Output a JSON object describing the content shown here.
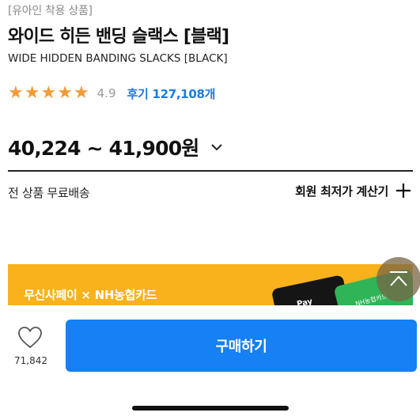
{
  "product": {
    "tag": "[유아인 착용 상품]",
    "title": "와이드 히든 밴딩 슬랙스 [블랙]",
    "subtitle": "WIDE HIDDEN BANDING SLACKS [BLACK]"
  },
  "rating": {
    "stars": 5,
    "star_color": "#f29b38",
    "score": "4.9",
    "reviews_label": "후기 127,108개"
  },
  "price": {
    "range": "40,224 ~ 41,900원"
  },
  "shipping": {
    "label": "전 상품 무료배송"
  },
  "member_price": {
    "label": "회원 최저가 계산기"
  },
  "banner": {
    "text": "무신사페이 × NH농협카드",
    "card_black_label": "Pay",
    "card_green_label": "NH농협카드",
    "background": "#f9b21b"
  },
  "bottom_bar": {
    "like_count": "71,842",
    "buy_label": "구매하기",
    "buy_color": "#1680f5"
  }
}
